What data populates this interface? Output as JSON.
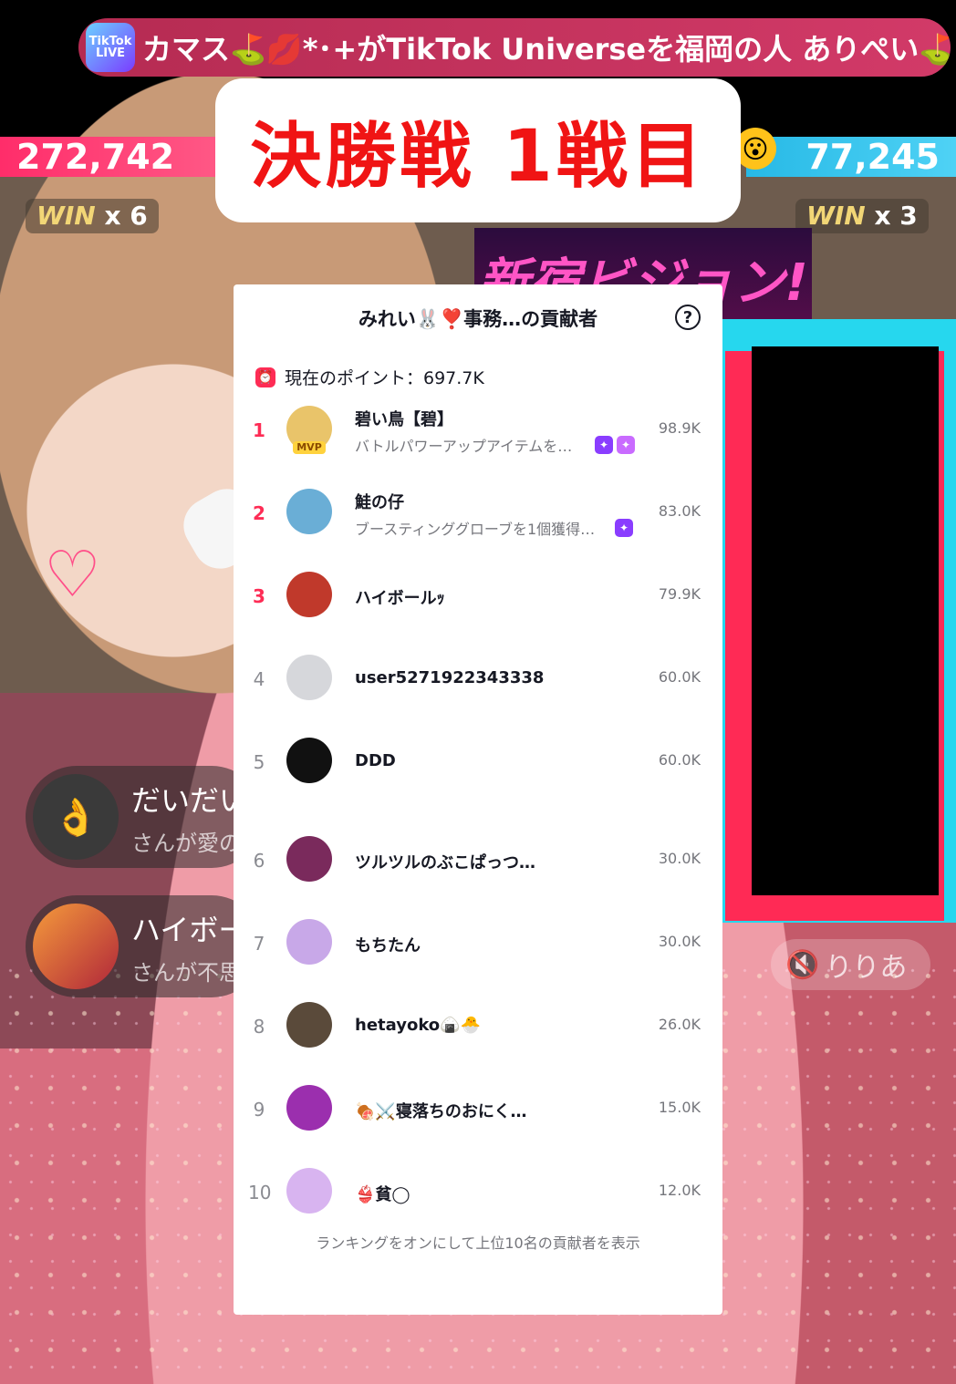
{
  "banner": {
    "logo": "TikTok LIVE",
    "text": "カマス⛳️💋*･+がTikTok Universeを福岡の人 ありぺい⛳️"
  },
  "battle": {
    "left_score": "272,742",
    "right_score": "77,245",
    "left_win_label": "WIN",
    "left_win_count": "x 6",
    "right_win_label": "WIN",
    "right_win_count": "x 3",
    "title": "決勝戦 1戦目"
  },
  "stream": {
    "sign_text": "新宿ビジョン!",
    "mute_label": "りりあ",
    "comments": [
      {
        "name": "だいだい",
        "sub": "さんが愛の"
      },
      {
        "name": "ハイボー",
        "sub": "さんが不思"
      }
    ]
  },
  "panel": {
    "title": "みれい🐰❣️事務…の貢献者",
    "help": "?",
    "points_label": "現在のポイント：697.7K",
    "footer": "ランキングをオンにして上位10名の貢献者を表示",
    "rows": [
      {
        "rank": "1",
        "name": "碧い鳥【碧】",
        "desc": "バトルパワーアップアイテムを…",
        "value": "98.9K",
        "badge": "MVP",
        "avatar_color": "#e9c46a"
      },
      {
        "rank": "2",
        "name": "鮭の仔",
        "desc": "ブースティンググローブを1個獲得…",
        "value": "83.0K",
        "avatar_color": "#6aaed6"
      },
      {
        "rank": "3",
        "name": "ハイボールｯ",
        "desc": "",
        "value": "79.9K",
        "avatar_color": "#c0392b"
      },
      {
        "rank": "4",
        "name": "user5271922343338",
        "desc": "",
        "value": "60.0K",
        "avatar_color": "#d6d7db"
      },
      {
        "rank": "5",
        "name": "DDD",
        "desc": "",
        "value": "60.0K",
        "avatar_color": "#111111"
      },
      {
        "rank": "6",
        "name": "ツルツルのぶこぱっつ…",
        "desc": "",
        "value": "30.0K",
        "avatar_color": "#7a2a5c"
      },
      {
        "rank": "7",
        "name": "もちたん",
        "desc": "",
        "value": "30.0K",
        "avatar_color": "#c8a8e8"
      },
      {
        "rank": "8",
        "name": "hetayoko🍙🐣",
        "desc": "",
        "value": "26.0K",
        "avatar_color": "#5a4a3a"
      },
      {
        "rank": "9",
        "name": "🍖⚔️寝落ちのおにく…",
        "desc": "",
        "value": "15.0K",
        "avatar_color": "#9b2fae"
      },
      {
        "rank": "10",
        "name": "👙貧◯",
        "desc": "",
        "value": "12.0K",
        "avatar_color": "#d8b4f0"
      }
    ]
  }
}
